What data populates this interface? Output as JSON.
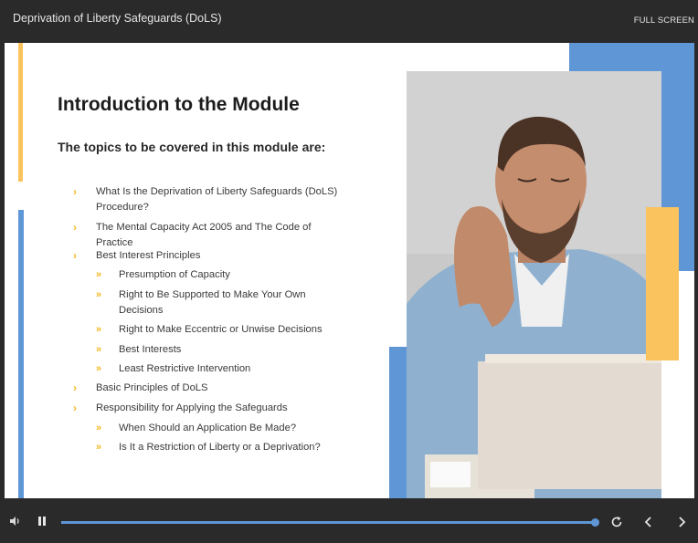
{
  "header": {
    "title": "Deprivation of Liberty Safeguards (DoLS)",
    "fullscreen_label": "FULL SCREEN"
  },
  "slide": {
    "heading": "Introduction to the Module",
    "subheading": "The topics to be covered in this module are:",
    "topics": [
      {
        "level": 1,
        "lines": [
          "What Is the Deprivation of Liberty Safeguards (DoLS)",
          "Procedure?"
        ]
      },
      {
        "level": 1,
        "lines": [
          "The Mental Capacity Act 2005 and The Code of",
          "Practice"
        ]
      },
      {
        "level": 1,
        "lines": [
          "Best Interest Principles"
        ]
      },
      {
        "level": 2,
        "lines": [
          "Presumption of Capacity"
        ]
      },
      {
        "level": 2,
        "lines": [
          "Right to Be Supported to Make Your Own",
          "Decisions"
        ]
      },
      {
        "level": 2,
        "lines": [
          "Right to Make Eccentric or Unwise Decisions"
        ]
      },
      {
        "level": 2,
        "lines": [
          "Best Interests"
        ]
      },
      {
        "level": 2,
        "lines": [
          "Least Restrictive Intervention"
        ]
      },
      {
        "level": 1,
        "lines": [
          "Basic Principles of DoLS"
        ]
      },
      {
        "level": 1,
        "lines": [
          "Responsibility for Applying the Safeguards"
        ]
      },
      {
        "level": 2,
        "lines": [
          "When Should an Application Be Made?"
        ]
      },
      {
        "level": 2,
        "lines": [
          "Is It a Restriction of Liberty or a Deprivation?"
        ]
      }
    ],
    "bullet_l1": "›",
    "bullet_l2": "»"
  },
  "player": {
    "progress": 1.0,
    "icons": [
      "volume-icon",
      "pause-icon",
      "replay-icon",
      "previous-icon",
      "next-icon"
    ]
  },
  "colors": {
    "accent_blue": "#5f96d6",
    "accent_yellow": "#fac35e",
    "bullet": "#f2b81f"
  }
}
